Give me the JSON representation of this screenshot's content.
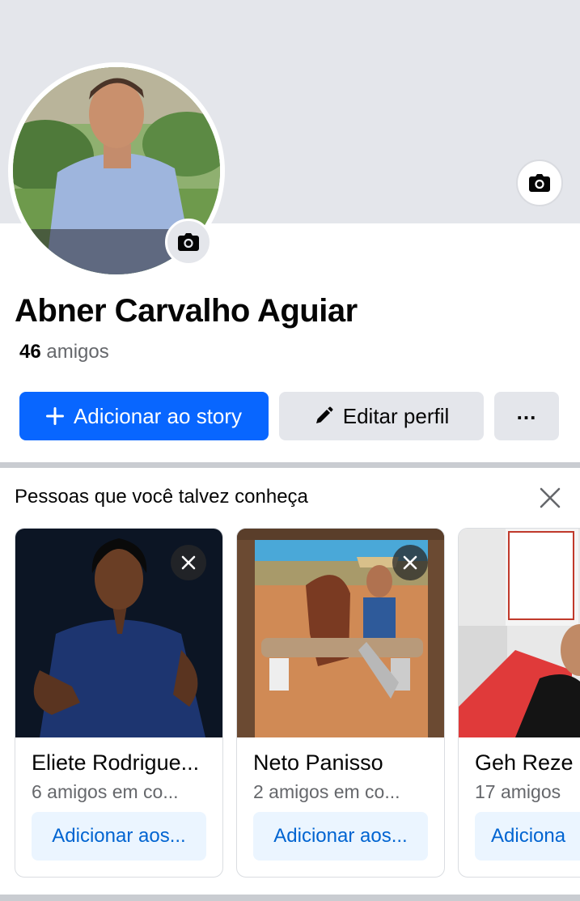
{
  "profile": {
    "name": "Abner Carvalho Aguiar",
    "friends_count": "46",
    "friends_label": "amigos"
  },
  "actions": {
    "add_story": "Adicionar ao story",
    "edit_profile": "Editar perfil",
    "more": "..."
  },
  "pymk": {
    "title": "Pessoas que você talvez conheça",
    "cards": [
      {
        "name": "Eliete Rodrigue...",
        "mutual": "6 amigos em co...",
        "button": "Adicionar aos..."
      },
      {
        "name": "Neto Panisso",
        "mutual": "2 amigos em co...",
        "button": "Adicionar aos..."
      },
      {
        "name": "Geh Reze",
        "mutual": "17 amigos",
        "button": "Adiciona"
      }
    ]
  },
  "colors": {
    "primary": "#0866ff",
    "secondary_button": "#e4e6eb",
    "light_blue_button": "#ebf5ff",
    "cover": "#e4e6eb"
  },
  "icons": [
    "camera-icon",
    "plus-icon",
    "pencil-icon",
    "close-icon"
  ]
}
